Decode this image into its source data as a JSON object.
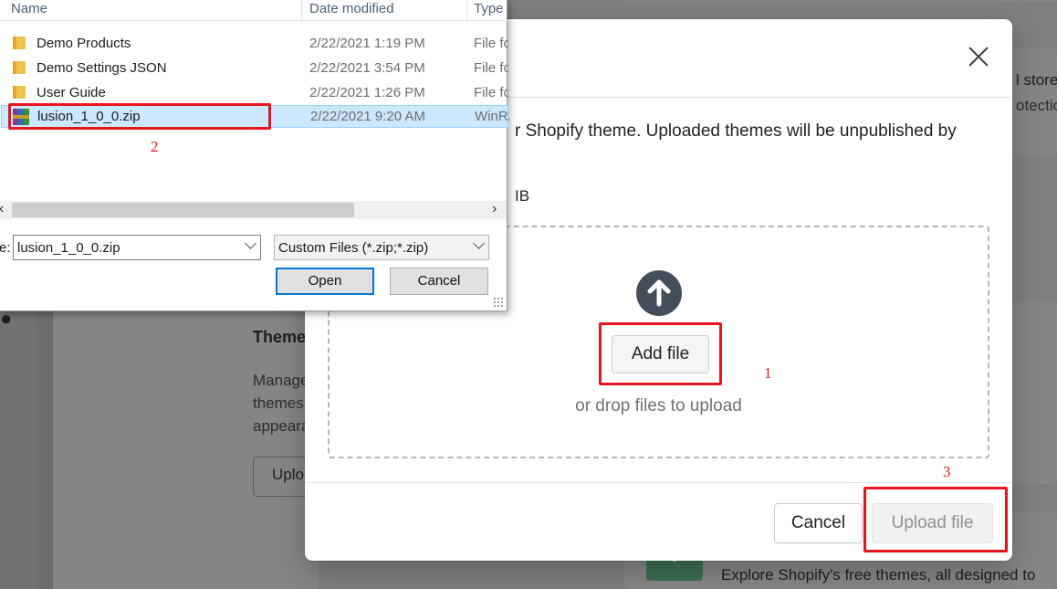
{
  "background_page": {
    "top_right_text_1": "l stores",
    "top_right_text_2": "otection",
    "section_title": "Theme",
    "section_desc_1": "Manage",
    "section_desc_2": "themes",
    "section_desc_3": "appeara",
    "upload_button_partial": "Uplo",
    "footer_text": "Explore Shopify's free themes, all designed to"
  },
  "modal": {
    "description": "r Shopify theme. Uploaded themes will be unpublished by",
    "size_note": "IB",
    "dropzone": {
      "upload_icon": "arrow-up-circle-icon",
      "add_file_label": "Add file",
      "drop_hint": "or drop files to upload"
    },
    "footer": {
      "cancel_label": "Cancel",
      "upload_label": "Upload file"
    }
  },
  "annotations": {
    "step_1": "1",
    "step_2": "2",
    "step_3": "3",
    "color": "#e8141e"
  },
  "file_dialog": {
    "columns": {
      "name": "Name",
      "date": "Date modified",
      "type": "Type"
    },
    "files": [
      {
        "name": "Demo Products",
        "date": "2/22/2021 1:19 PM",
        "type": "File fo",
        "icon": "folder-icon"
      },
      {
        "name": "Demo Settings JSON",
        "date": "2/22/2021 3:54 PM",
        "type": "File fo",
        "icon": "folder-icon"
      },
      {
        "name": "User Guide",
        "date": "2/22/2021 1:26 PM",
        "type": "File fo",
        "icon": "folder-icon"
      },
      {
        "name": "lusion_1_0_0.zip",
        "date": "2/22/2021 9:20 AM",
        "type": "WinRA",
        "icon": "winrar-archive-icon",
        "selected": true
      }
    ],
    "filename_label": "e:",
    "filename_value": "lusion_1_0_0.zip",
    "filter_value": "Custom Files (*.zip;*.zip)",
    "open_label": "Open",
    "cancel_label": "Cancel",
    "selection_color": "#cce8ff"
  }
}
